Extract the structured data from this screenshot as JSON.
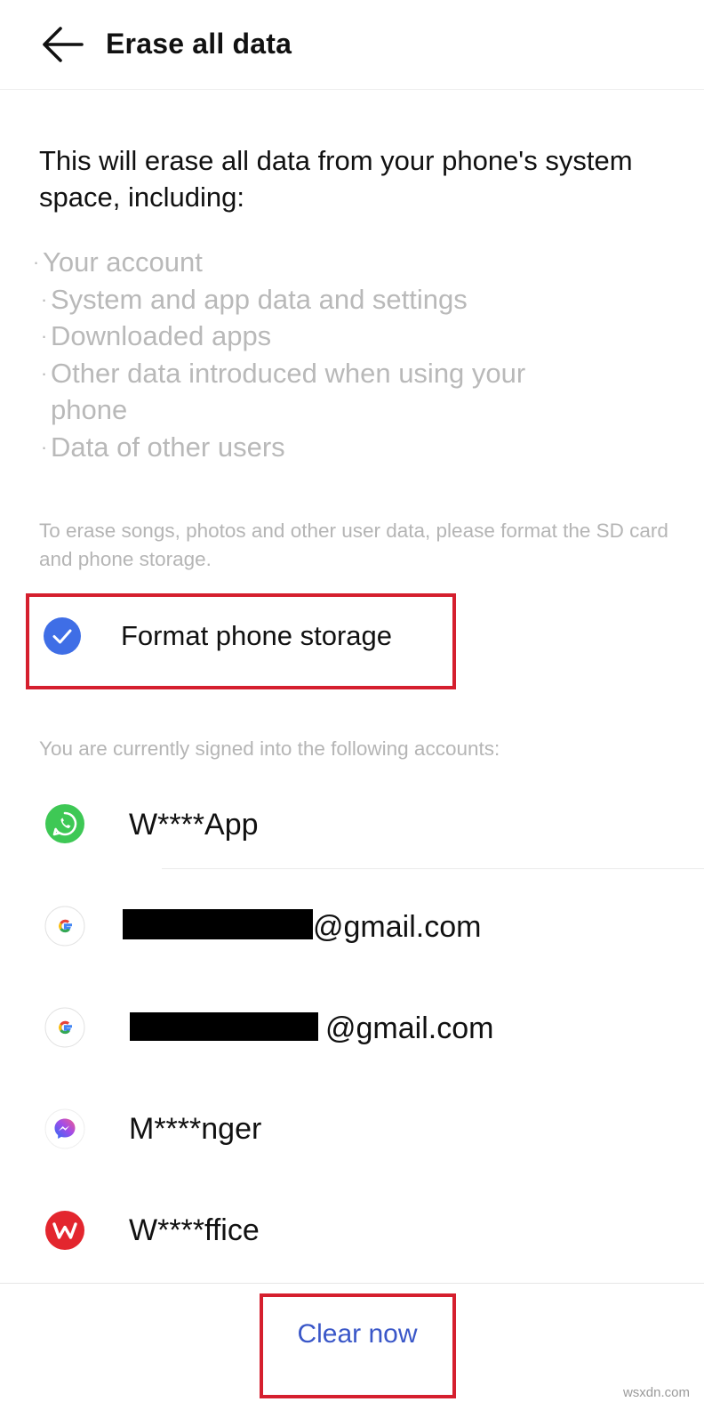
{
  "header": {
    "back_icon": "arrow-left-icon",
    "title": "Erase all data"
  },
  "intro": "This will erase all data from your phone's system space, including:",
  "erase_items": [
    "Your account",
    "System and app data and settings",
    "Downloaded apps",
    "Other data introduced when using your phone",
    "Data of other users"
  ],
  "storage_note": "To erase songs, photos and other user data, please format the SD card and phone storage.",
  "format_option": {
    "label": "Format phone storage",
    "checked": true,
    "check_color": "#3f6ee6"
  },
  "accounts_note": "You are currently signed into the following accounts:",
  "accounts": [
    {
      "label": "W****App",
      "icon": "whatsapp-icon"
    },
    {
      "label": "@gmail.com",
      "icon": "google-icon",
      "redacted": true
    },
    {
      "label": "@gmail.com",
      "icon": "google-icon",
      "redacted": true
    },
    {
      "label": "M****nger",
      "icon": "messenger-icon"
    },
    {
      "label": "W****ffice",
      "icon": "wps-office-icon"
    }
  ],
  "action": {
    "clear_label": "Clear now",
    "color": "#3a57c8"
  },
  "highlight_color": "#d51f2e",
  "watermark": "wsxdn.com"
}
